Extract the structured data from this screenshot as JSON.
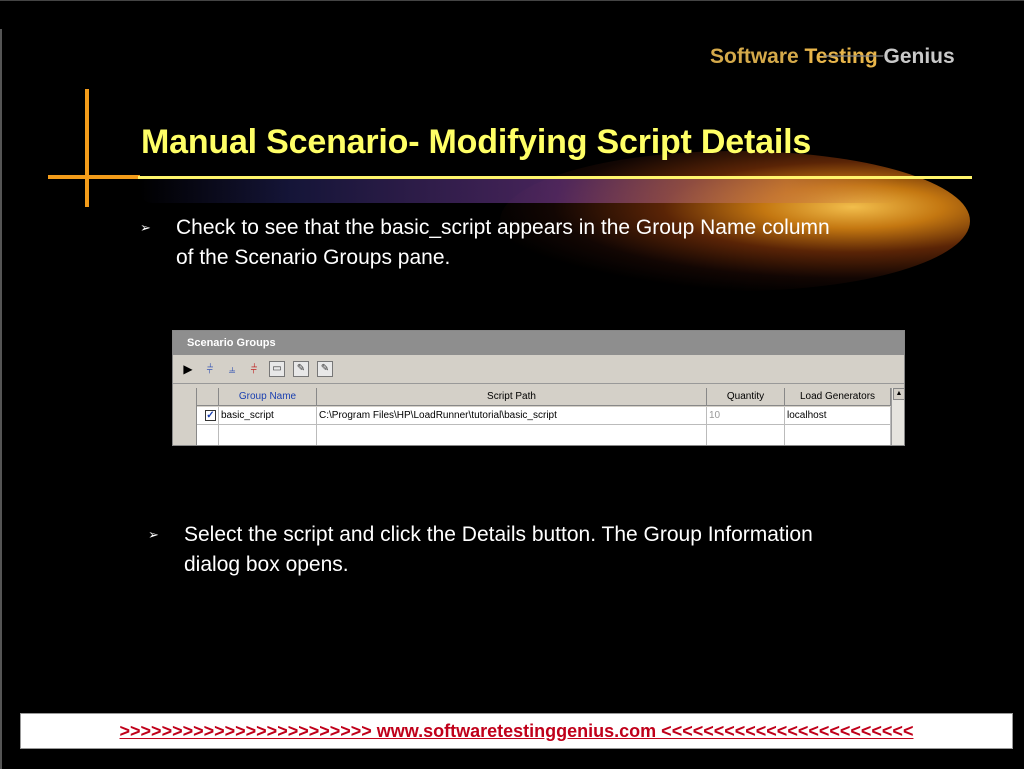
{
  "logo": {
    "word1": "Software ",
    "word2": "Testing",
    "word3": " Genius"
  },
  "title": "Manual Scenario- Modifying Script Details",
  "bullets": [
    {
      "line1": "Check to see that the basic_script appears in the Group Name column",
      "line2": "of the Scenario Groups pane."
    },
    {
      "line1": "Select the script and click the Details button. The Group Information",
      "line2": "dialog box opens."
    }
  ],
  "bullet_marker": "➢",
  "pane": {
    "title": "Scenario Groups",
    "toolbar_icons": [
      "play-icon",
      "add-vusers-icon",
      "vusers-icon",
      "stop-vusers-icon",
      "delete-icon",
      "details-icon",
      "edit-icon"
    ],
    "columns": [
      "Group Name",
      "Script Path",
      "Quantity",
      "Load Generators"
    ],
    "rows": [
      {
        "checked": true,
        "group_name": "basic_script",
        "script_path": "C:\\Program Files\\HP\\LoadRunner\\tutorial\\basic_script",
        "quantity": "10",
        "load_generators": "localhost"
      }
    ]
  },
  "footer": ">>>>>>>>>>>>>>>>>>>>>>>>  www.softwaretestinggenius.com  <<<<<<<<<<<<<<<<<<<<<<<<",
  "colors": {
    "title": "#ffff66",
    "accent_orange": "#f39c1a",
    "footer_text": "#c0001a"
  }
}
